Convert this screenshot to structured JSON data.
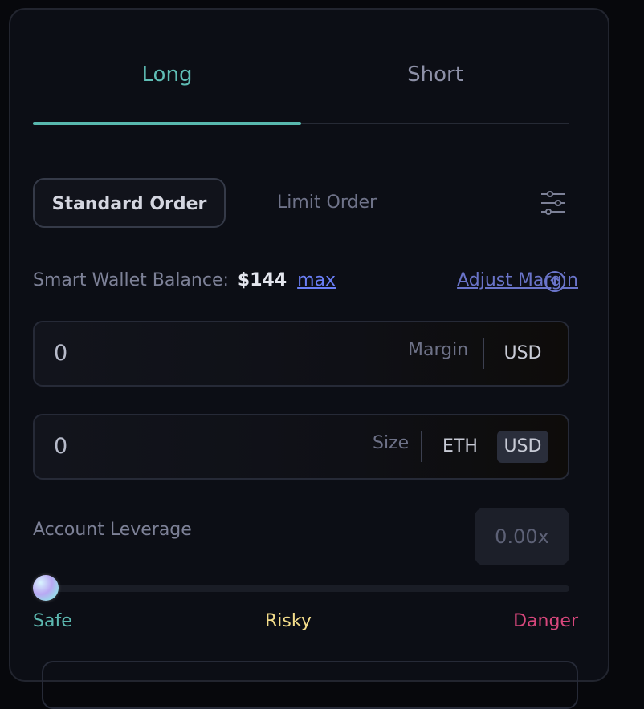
{
  "tabs": {
    "long_label": "Long",
    "short_label": "Short",
    "active": "Long"
  },
  "order_types": {
    "standard_label": "Standard Order",
    "limit_label": "Limit Order",
    "active": "Standard Order"
  },
  "balance": {
    "label": "Smart Wallet Balance:",
    "amount": "$144",
    "max_label": "max",
    "adjust_label": "Adjust Margin"
  },
  "margin_field": {
    "value": "0",
    "label": "Margin",
    "unit": "USD"
  },
  "size_field": {
    "value": "0",
    "label": "Size",
    "units": [
      "ETH",
      "USD"
    ],
    "active_unit": "USD"
  },
  "leverage": {
    "label": "Account Leverage",
    "value": "0.00x",
    "slider_level": 0,
    "scale_labels": {
      "safe": "Safe",
      "risky": "Risky",
      "danger": "Danger"
    }
  },
  "colors": {
    "accent_teal": "#58b8ae",
    "link_blue": "#6a7ef5",
    "risky_yellow": "#f3dc8a",
    "danger_pink": "#d8477c"
  },
  "icons": {
    "settings": "sliders-icon",
    "adjust_margin": "arrow-up-circle-icon"
  }
}
